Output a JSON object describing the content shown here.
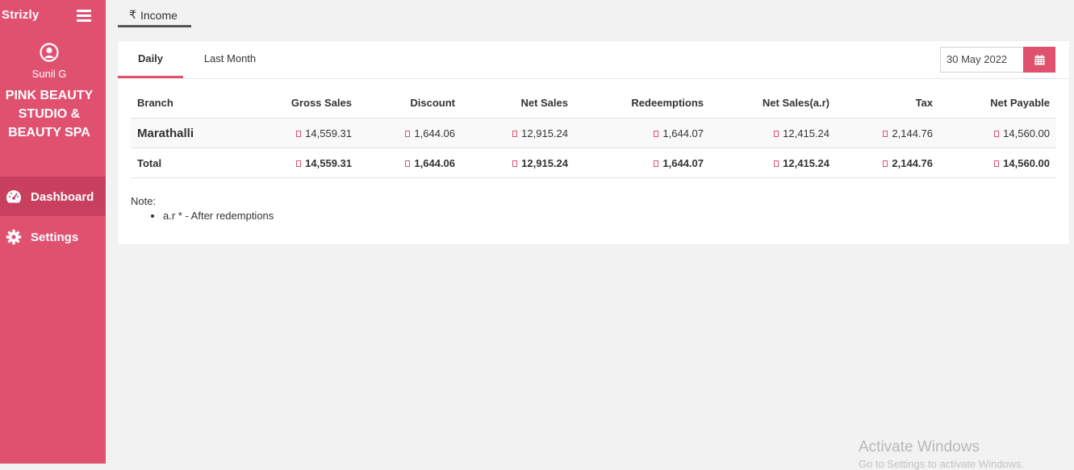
{
  "sidebar": {
    "brand": "Strizly",
    "user_name": "Sunil G",
    "business_name": "PINK BEAUTY STUDIO & BEAUTY SPA",
    "items": [
      {
        "label": "Dashboard",
        "icon": "dashboard-gauge-icon",
        "active": true
      },
      {
        "label": "Settings",
        "icon": "gear-icon",
        "active": false
      }
    ]
  },
  "header": {
    "tab_label": "Income",
    "tab_icon": "rupee-icon"
  },
  "card": {
    "tabs": [
      {
        "label": "Daily",
        "active": true
      },
      {
        "label": "Last Month",
        "active": false
      }
    ],
    "date_value": "30 May 2022",
    "date_icon": "calendar-icon"
  },
  "table": {
    "columns": [
      "Branch",
      "Gross Sales",
      "Discount",
      "Net Sales",
      "Redeemptions",
      "Net Sales(a.r)",
      "Tax",
      "Net Payable"
    ],
    "rows": [
      {
        "branch": "Marathalli",
        "gross": "14,559.31",
        "discount": "1,644.06",
        "net": "12,915.24",
        "redemptions": "1,644.07",
        "net_ar": "12,415.24",
        "tax": "2,144.76",
        "payable": "14,560.00"
      }
    ],
    "total": {
      "label": "Total",
      "gross": "14,559.31",
      "discount": "1,644.06",
      "net": "12,915.24",
      "redemptions": "1,644.07",
      "net_ar": "12,415.24",
      "tax": "2,144.76",
      "payable": "14,560.00"
    }
  },
  "note": {
    "title": "Note:",
    "items": [
      "a.r * - After redemptions"
    ]
  },
  "watermark": {
    "line1": "Activate Windows",
    "line2": "Go to Settings to activate Windows."
  },
  "colors": {
    "accent": "#e05170",
    "accent_dark": "#c93f5e"
  }
}
